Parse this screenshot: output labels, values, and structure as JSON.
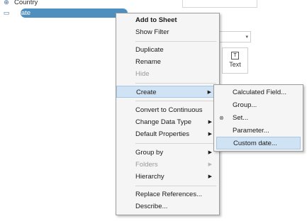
{
  "data_pane": {
    "fields": [
      {
        "label": "Country",
        "icon": "globe-icon",
        "icon_glyph": "⊕"
      },
      {
        "label": "Date",
        "icon": "calendar-icon",
        "icon_glyph": "▭",
        "selected": true
      }
    ]
  },
  "background": {
    "text_card_label": "Text",
    "text_card_glyph": "T",
    "dropdown_arrow": "▾"
  },
  "context_menu": {
    "items": [
      {
        "label": "Add to Sheet",
        "bold": true
      },
      {
        "label": "Show Filter"
      },
      {
        "label": "Duplicate"
      },
      {
        "label": "Rename"
      },
      {
        "label": "Hide",
        "disabled": true
      },
      {
        "label": "Create",
        "submenu": true,
        "highlighted": true
      },
      {
        "label": "Convert to Continuous"
      },
      {
        "label": "Change Data Type",
        "submenu": true
      },
      {
        "label": "Default Properties",
        "submenu": true
      },
      {
        "label": "Group by",
        "submenu": true
      },
      {
        "label": "Folders",
        "submenu": true,
        "disabled": true
      },
      {
        "label": "Hierarchy",
        "submenu": true
      },
      {
        "label": "Replace References..."
      },
      {
        "label": "Describe..."
      }
    ],
    "submenu_arrow": "▶"
  },
  "create_submenu": {
    "items": [
      {
        "label": "Calculated Field..."
      },
      {
        "label": "Group..."
      },
      {
        "label": "Set...",
        "icon": "set-icon",
        "icon_glyph": "⊗"
      },
      {
        "label": "Parameter..."
      },
      {
        "label": "Custom date...",
        "highlighted": true
      }
    ]
  },
  "colors": {
    "selection_pill": "#4f8fbf",
    "menu_highlight": "#cfe3f5",
    "menu_background": "#f5f5f5"
  }
}
